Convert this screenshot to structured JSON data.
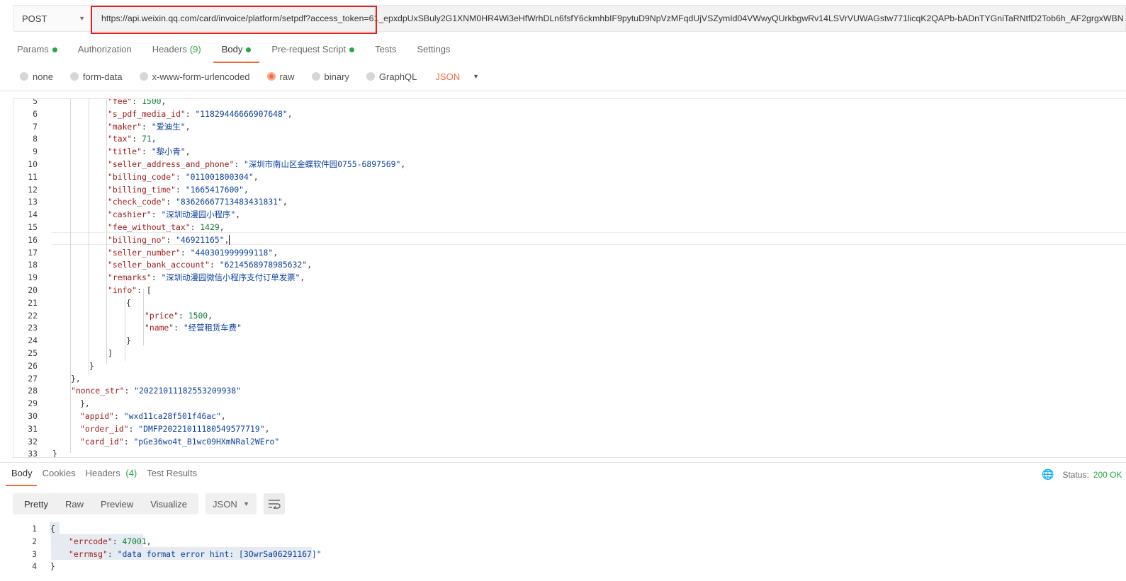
{
  "request": {
    "method": "POST",
    "url": "https://api.weixin.qq.com/card/invoice/platform/setpdf?access_token=61_epxdpUxSBuly2G1XNM0HR4Wi3eHfWrhDLn6fsfY6ckmhbIF9pytuD9NpVzMFqdUjVSZymId04VWwyQUrkbgwRv14LSVrVUWAGstw771licqK2QAPb-bADnTYGniTaRNtfD2Tob6h_AF2grgxWBN"
  },
  "request_tabs": [
    {
      "label": "Params",
      "dot": true
    },
    {
      "label": "Authorization"
    },
    {
      "label": "Headers",
      "count": "(9)"
    },
    {
      "label": "Body",
      "dot": true,
      "active": true
    },
    {
      "label": "Pre-request Script",
      "dot": true
    },
    {
      "label": "Tests"
    },
    {
      "label": "Settings"
    }
  ],
  "body_modes": [
    "none",
    "form-data",
    "x-www-form-urlencoded",
    "raw",
    "binary",
    "GraphQL"
  ],
  "body_mode_selected": "raw",
  "body_format": "JSON",
  "editor_lines": [
    {
      "n": "5",
      "indent": 2,
      "parts": [
        [
          "k",
          "\"fee\""
        ],
        [
          "p",
          ": "
        ],
        [
          "n",
          "1500"
        ],
        [
          "p",
          ","
        ]
      ]
    },
    {
      "n": "6",
      "indent": 2,
      "parts": [
        [
          "k",
          "\"s_pdf_media_id\""
        ],
        [
          "p",
          ": "
        ],
        [
          "s",
          "\"11829446666907648\""
        ],
        [
          "p",
          ","
        ]
      ]
    },
    {
      "n": "7",
      "indent": 2,
      "parts": [
        [
          "k",
          "\"maker\""
        ],
        [
          "p",
          ": "
        ],
        [
          "s",
          "\"爱迪生\""
        ],
        [
          "p",
          ","
        ]
      ]
    },
    {
      "n": "8",
      "indent": 2,
      "parts": [
        [
          "k",
          "\"tax\""
        ],
        [
          "p",
          ": "
        ],
        [
          "n",
          "71"
        ],
        [
          "p",
          ","
        ]
      ]
    },
    {
      "n": "9",
      "indent": 2,
      "parts": [
        [
          "k",
          "\"title\""
        ],
        [
          "p",
          ": "
        ],
        [
          "s",
          "\"黎小青\""
        ],
        [
          "p",
          ","
        ]
      ]
    },
    {
      "n": "10",
      "indent": 2,
      "parts": [
        [
          "k",
          "\"seller_address_and_phone\""
        ],
        [
          "p",
          ": "
        ],
        [
          "s",
          "\"深圳市南山区金蝶软件园0755-6897569\""
        ],
        [
          "p",
          ","
        ]
      ]
    },
    {
      "n": "11",
      "indent": 2,
      "parts": [
        [
          "k",
          "\"billing_code\""
        ],
        [
          "p",
          ": "
        ],
        [
          "s",
          "\"011001800304\""
        ],
        [
          "p",
          ","
        ]
      ]
    },
    {
      "n": "12",
      "indent": 2,
      "parts": [
        [
          "k",
          "\"billing_time\""
        ],
        [
          "p",
          ": "
        ],
        [
          "s",
          "\"1665417600\""
        ],
        [
          "p",
          ","
        ]
      ]
    },
    {
      "n": "13",
      "indent": 2,
      "parts": [
        [
          "k",
          "\"check_code\""
        ],
        [
          "p",
          ": "
        ],
        [
          "s",
          "\"83626667713483431831\""
        ],
        [
          "p",
          ","
        ]
      ]
    },
    {
      "n": "14",
      "indent": 2,
      "parts": [
        [
          "k",
          "\"cashier\""
        ],
        [
          "p",
          ": "
        ],
        [
          "s",
          "\"深圳动漫园小程序\""
        ],
        [
          "p",
          ","
        ]
      ]
    },
    {
      "n": "15",
      "indent": 2,
      "parts": [
        [
          "k",
          "\"fee_without_tax\""
        ],
        [
          "p",
          ": "
        ],
        [
          "n",
          "1429"
        ],
        [
          "p",
          ","
        ]
      ]
    },
    {
      "n": "16",
      "indent": 2,
      "parts": [
        [
          "k",
          "\"billing_no\""
        ],
        [
          "p",
          ": "
        ],
        [
          "s",
          "\"46921165\""
        ],
        [
          "p",
          ","
        ]
      ],
      "cursor": true
    },
    {
      "n": "17",
      "indent": 2,
      "parts": [
        [
          "k",
          "\"seller_number\""
        ],
        [
          "p",
          ": "
        ],
        [
          "s",
          "\"440301999999118\""
        ],
        [
          "p",
          ","
        ]
      ]
    },
    {
      "n": "18",
      "indent": 2,
      "parts": [
        [
          "k",
          "\"seller_bank_account\""
        ],
        [
          "p",
          ": "
        ],
        [
          "s",
          "\"6214568978985632\""
        ],
        [
          "p",
          ","
        ]
      ]
    },
    {
      "n": "19",
      "indent": 2,
      "parts": [
        [
          "k",
          "\"remarks\""
        ],
        [
          "p",
          ": "
        ],
        [
          "s",
          "\"深圳动漫园微信小程序支付订单发票\""
        ],
        [
          "p",
          ","
        ]
      ]
    },
    {
      "n": "20",
      "indent": 2,
      "parts": [
        [
          "k",
          "\"info\""
        ],
        [
          "p",
          ": ["
        ]
      ]
    },
    {
      "n": "21",
      "indent": 3,
      "parts": [
        [
          "p",
          "{"
        ]
      ]
    },
    {
      "n": "22",
      "indent": 4,
      "parts": [
        [
          "k",
          "\"price\""
        ],
        [
          "p",
          ": "
        ],
        [
          "n",
          "1500"
        ],
        [
          "p",
          ","
        ]
      ]
    },
    {
      "n": "23",
      "indent": 4,
      "parts": [
        [
          "k",
          "\"name\""
        ],
        [
          "p",
          ": "
        ],
        [
          "s",
          "\"经营租赁车费\""
        ]
      ]
    },
    {
      "n": "24",
      "indent": 3,
      "parts": [
        [
          "p",
          "}"
        ]
      ]
    },
    {
      "n": "25",
      "indent": 2,
      "parts": [
        [
          "p",
          "]"
        ]
      ]
    },
    {
      "n": "26",
      "indent": 1,
      "parts": [
        [
          "p",
          "}"
        ]
      ]
    },
    {
      "n": "27",
      "indent": 1,
      "parts": [
        [
          "p",
          "},"
        ]
      ],
      "shift": -2
    },
    {
      "n": "28",
      "indent": 1,
      "parts": [
        [
          "k",
          "\"nonce_str\""
        ],
        [
          "p",
          ": "
        ],
        [
          "s",
          "\"20221011182553209938\""
        ]
      ],
      "shift": -2
    },
    {
      "n": "29",
      "indent": 0,
      "parts": [
        [
          "p",
          "},"
        ]
      ],
      "shift": 1
    },
    {
      "n": "30",
      "indent": 0,
      "parts": [
        [
          "k",
          "\"appid\""
        ],
        [
          "p",
          ": "
        ],
        [
          "s",
          "\"wxd11ca28f501f46ac\""
        ],
        [
          "p",
          ","
        ]
      ],
      "shift": 1
    },
    {
      "n": "31",
      "indent": 0,
      "parts": [
        [
          "k",
          "\"order_id\""
        ],
        [
          "p",
          ": "
        ],
        [
          "s",
          "\"DMFP20221011180549577719\""
        ],
        [
          "p",
          ","
        ]
      ],
      "shift": 1
    },
    {
      "n": "32",
      "indent": 0,
      "parts": [
        [
          "k",
          "\"card_id\""
        ],
        [
          "p",
          ": "
        ],
        [
          "s",
          "\"pGe36wo4t_B1wc09HXmNRal2WEro\""
        ]
      ],
      "shift": 1
    },
    {
      "n": "33",
      "indent": -1,
      "parts": [
        [
          "p",
          "}"
        ]
      ]
    }
  ],
  "response_tabs": [
    {
      "label": "Body",
      "active": true
    },
    {
      "label": "Cookies"
    },
    {
      "label": "Headers",
      "count": "(4)"
    },
    {
      "label": "Test Results"
    }
  ],
  "status": {
    "label": "Status:",
    "value": "200 OK"
  },
  "response_views": [
    "Pretty",
    "Raw",
    "Preview",
    "Visualize"
  ],
  "response_view_selected": "Pretty",
  "response_format": "JSON",
  "response_lines": [
    {
      "n": "1",
      "indent": 0,
      "parts": [
        [
          "p",
          "{"
        ]
      ]
    },
    {
      "n": "2",
      "indent": 1,
      "parts": [
        [
          "k",
          "\"errcode\""
        ],
        [
          "p",
          ": "
        ],
        [
          "n",
          "47001"
        ],
        [
          "p",
          ","
        ]
      ]
    },
    {
      "n": "3",
      "indent": 1,
      "parts": [
        [
          "k",
          "\"errmsg\""
        ],
        [
          "p",
          ": "
        ],
        [
          "s",
          "\"data format error hint: [3OwrSa06291167]\""
        ]
      ]
    },
    {
      "n": "4",
      "indent": 0,
      "parts": [
        [
          "p",
          "}"
        ]
      ]
    }
  ],
  "colors": {
    "accent": "#f26b3a",
    "success": "#27a744",
    "highlight": "#e0221b"
  }
}
